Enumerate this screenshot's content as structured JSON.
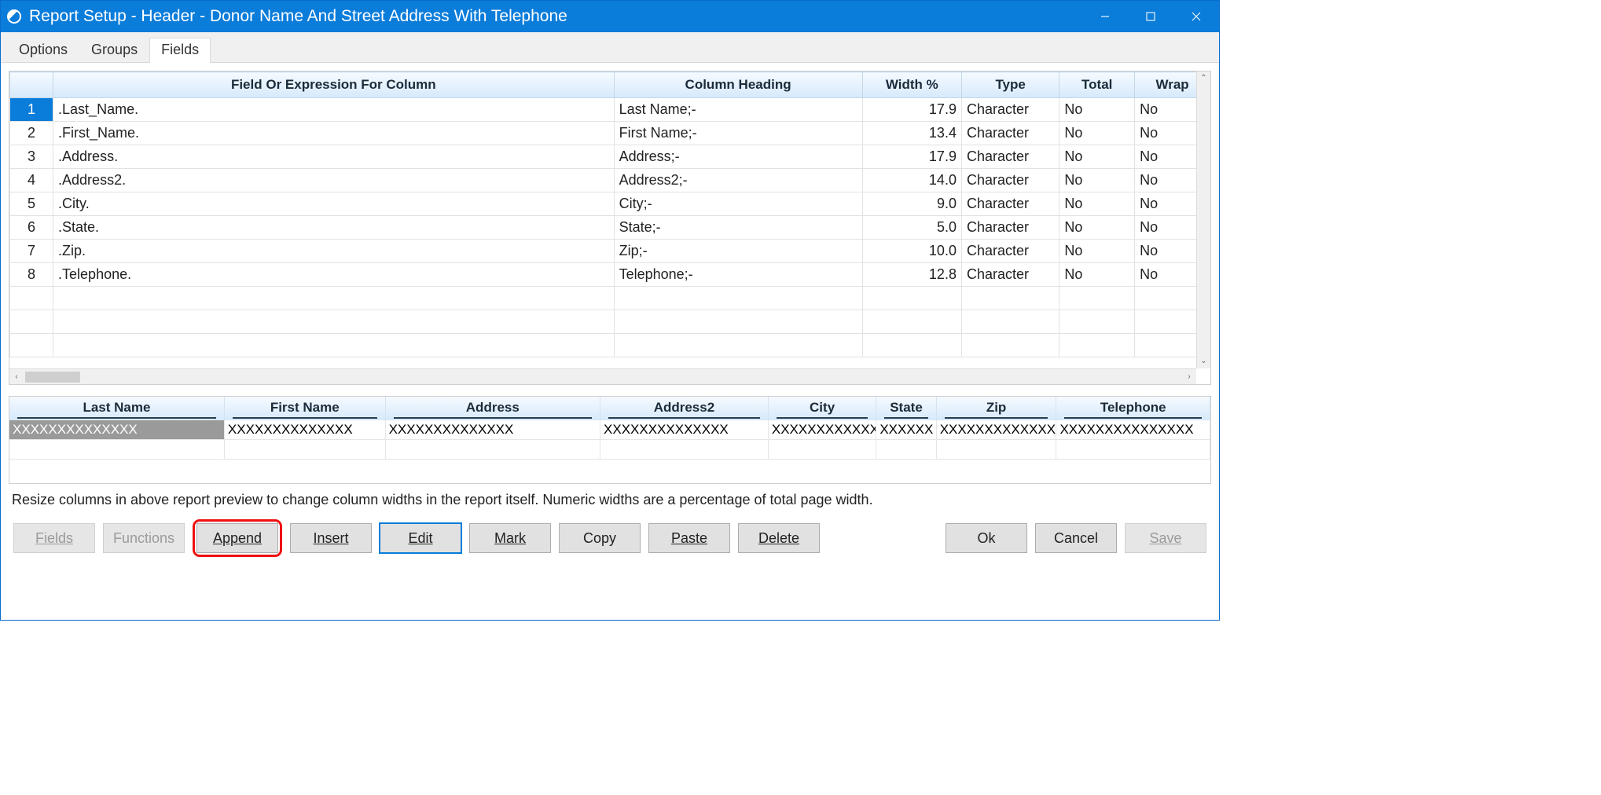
{
  "window": {
    "title": "Report Setup - Header - Donor Name And Street Address With Telephone"
  },
  "tabs": [
    {
      "label": "Options",
      "active": false
    },
    {
      "label": "Groups",
      "active": false
    },
    {
      "label": "Fields",
      "active": true
    }
  ],
  "grid": {
    "headers": {
      "rownum": "",
      "expr": "Field Or Expression For Column",
      "heading": "Column Heading",
      "width": "Width %",
      "type": "Type",
      "total": "Total",
      "wrap": "Wrap"
    },
    "rows": [
      {
        "n": "1",
        "expr": ".Last_Name.",
        "heading": "Last Name;-",
        "width": "17.9",
        "type": "Character",
        "total": "No",
        "wrap": "No",
        "selected": true
      },
      {
        "n": "2",
        "expr": ".First_Name.",
        "heading": "First Name;-",
        "width": "13.4",
        "type": "Character",
        "total": "No",
        "wrap": "No"
      },
      {
        "n": "3",
        "expr": ".Address.",
        "heading": "Address;-",
        "width": "17.9",
        "type": "Character",
        "total": "No",
        "wrap": "No"
      },
      {
        "n": "4",
        "expr": ".Address2.",
        "heading": "Address2;-",
        "width": "14.0",
        "type": "Character",
        "total": "No",
        "wrap": "No"
      },
      {
        "n": "5",
        "expr": ".City.",
        "heading": "City;-",
        "width": "9.0",
        "type": "Character",
        "total": "No",
        "wrap": "No"
      },
      {
        "n": "6",
        "expr": ".State.",
        "heading": "State;-",
        "width": "5.0",
        "type": "Character",
        "total": "No",
        "wrap": "No"
      },
      {
        "n": "7",
        "expr": ".Zip.",
        "heading": "Zip;-",
        "width": "10.0",
        "type": "Character",
        "total": "No",
        "wrap": "No"
      },
      {
        "n": "8",
        "expr": ".Telephone.",
        "heading": "Telephone;-",
        "width": "12.8",
        "type": "Character",
        "total": "No",
        "wrap": "No"
      }
    ]
  },
  "preview": {
    "headers": [
      "Last Name",
      "First Name",
      "Address",
      "Address2",
      "City",
      "State",
      "Zip",
      "Telephone"
    ],
    "widths_pct": [
      17.9,
      13.4,
      17.9,
      14.0,
      9.0,
      5.0,
      10.0,
      12.8
    ],
    "row": [
      "XXXXXXXXXXXXXX",
      "XXXXXXXXXXXXXX",
      "XXXXXXXXXXXXXX",
      "XXXXXXXXXXXXXX",
      "XXXXXXXXXXXXX",
      "XXXXXX",
      "XXXXXXXXXXXXXXX",
      "XXXXXXXXXXXXXXX"
    ]
  },
  "hint": "Resize columns in above report preview to change column widths in the report itself. Numeric widths are a percentage of total page width.",
  "buttons": {
    "fields": "Fields",
    "functions": "Functions",
    "append": "Append",
    "insert": "Insert",
    "edit": "Edit",
    "mark": "Mark",
    "copy": "Copy",
    "paste": "Paste",
    "delete": "Delete",
    "ok": "Ok",
    "cancel": "Cancel",
    "save": "Save"
  }
}
